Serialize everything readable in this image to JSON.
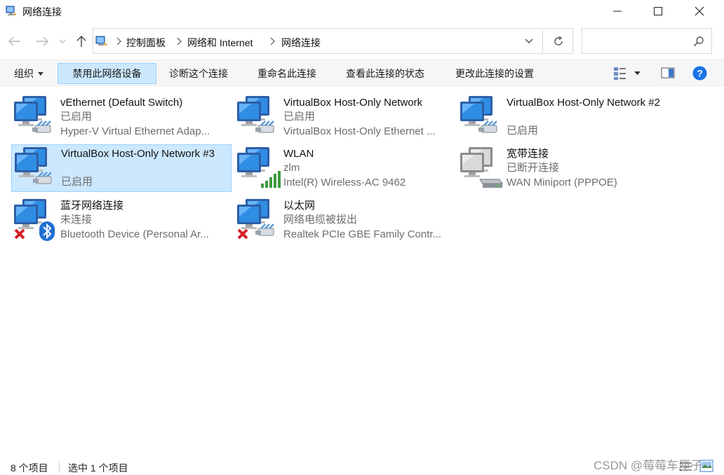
{
  "window": {
    "title": "网络连接"
  },
  "address": {
    "breadcrumbs": [
      "控制面板",
      "网络和 Internet",
      "网络连接"
    ],
    "search_placeholder": ""
  },
  "commands": {
    "organize": "组织",
    "disable": "禁用此网络设备",
    "diagnose": "诊断这个连接",
    "rename": "重命名此连接",
    "view_status": "查看此连接的状态",
    "change_settings": "更改此连接的设置"
  },
  "connections": [
    {
      "name": "vEthernet (Default Switch)",
      "status": "已启用",
      "device": "Hyper-V Virtual Ethernet Adap...",
      "icon": "ethernet-icon",
      "badge": "cable"
    },
    {
      "name": "VirtualBox Host-Only Network",
      "status": "已启用",
      "device": "VirtualBox Host-Only Ethernet ...",
      "icon": "ethernet-icon",
      "badge": "cable"
    },
    {
      "name": "VirtualBox Host-Only Network #2",
      "status": "已启用",
      "device": "",
      "icon": "ethernet-icon",
      "badge": "cable"
    },
    {
      "name": "VirtualBox Host-Only Network #3",
      "status": "已启用",
      "device": "",
      "icon": "ethernet-icon",
      "badge": "cable",
      "selected": true
    },
    {
      "name": "WLAN",
      "status": "zlm",
      "device": "Intel(R) Wireless-AC 9462",
      "icon": "wifi-icon",
      "badge": "signal"
    },
    {
      "name": "宽带连接",
      "status": "已断开连接",
      "device": "WAN Miniport (PPPOE)",
      "icon": "broadband-icon",
      "badge": "modem"
    },
    {
      "name": "蓝牙网络连接",
      "status": "未连接",
      "device": "Bluetooth Device (Personal Ar...",
      "icon": "bluetooth-icon",
      "badge": "bluetooth-x"
    },
    {
      "name": "以太网",
      "status": "网络电缆被拔出",
      "device": "Realtek PCIe GBE Family Contr...",
      "icon": "ethernet-icon",
      "badge": "cable-x"
    }
  ],
  "status_bar": {
    "count": "8 个项目",
    "selection": "选中 1 个项目"
  },
  "watermark": "CSDN @莓莓车厘子",
  "colors": {
    "selection_bg": "#cce8ff",
    "selection_border": "#99d1ff",
    "help_blue": "#1a73e8"
  }
}
